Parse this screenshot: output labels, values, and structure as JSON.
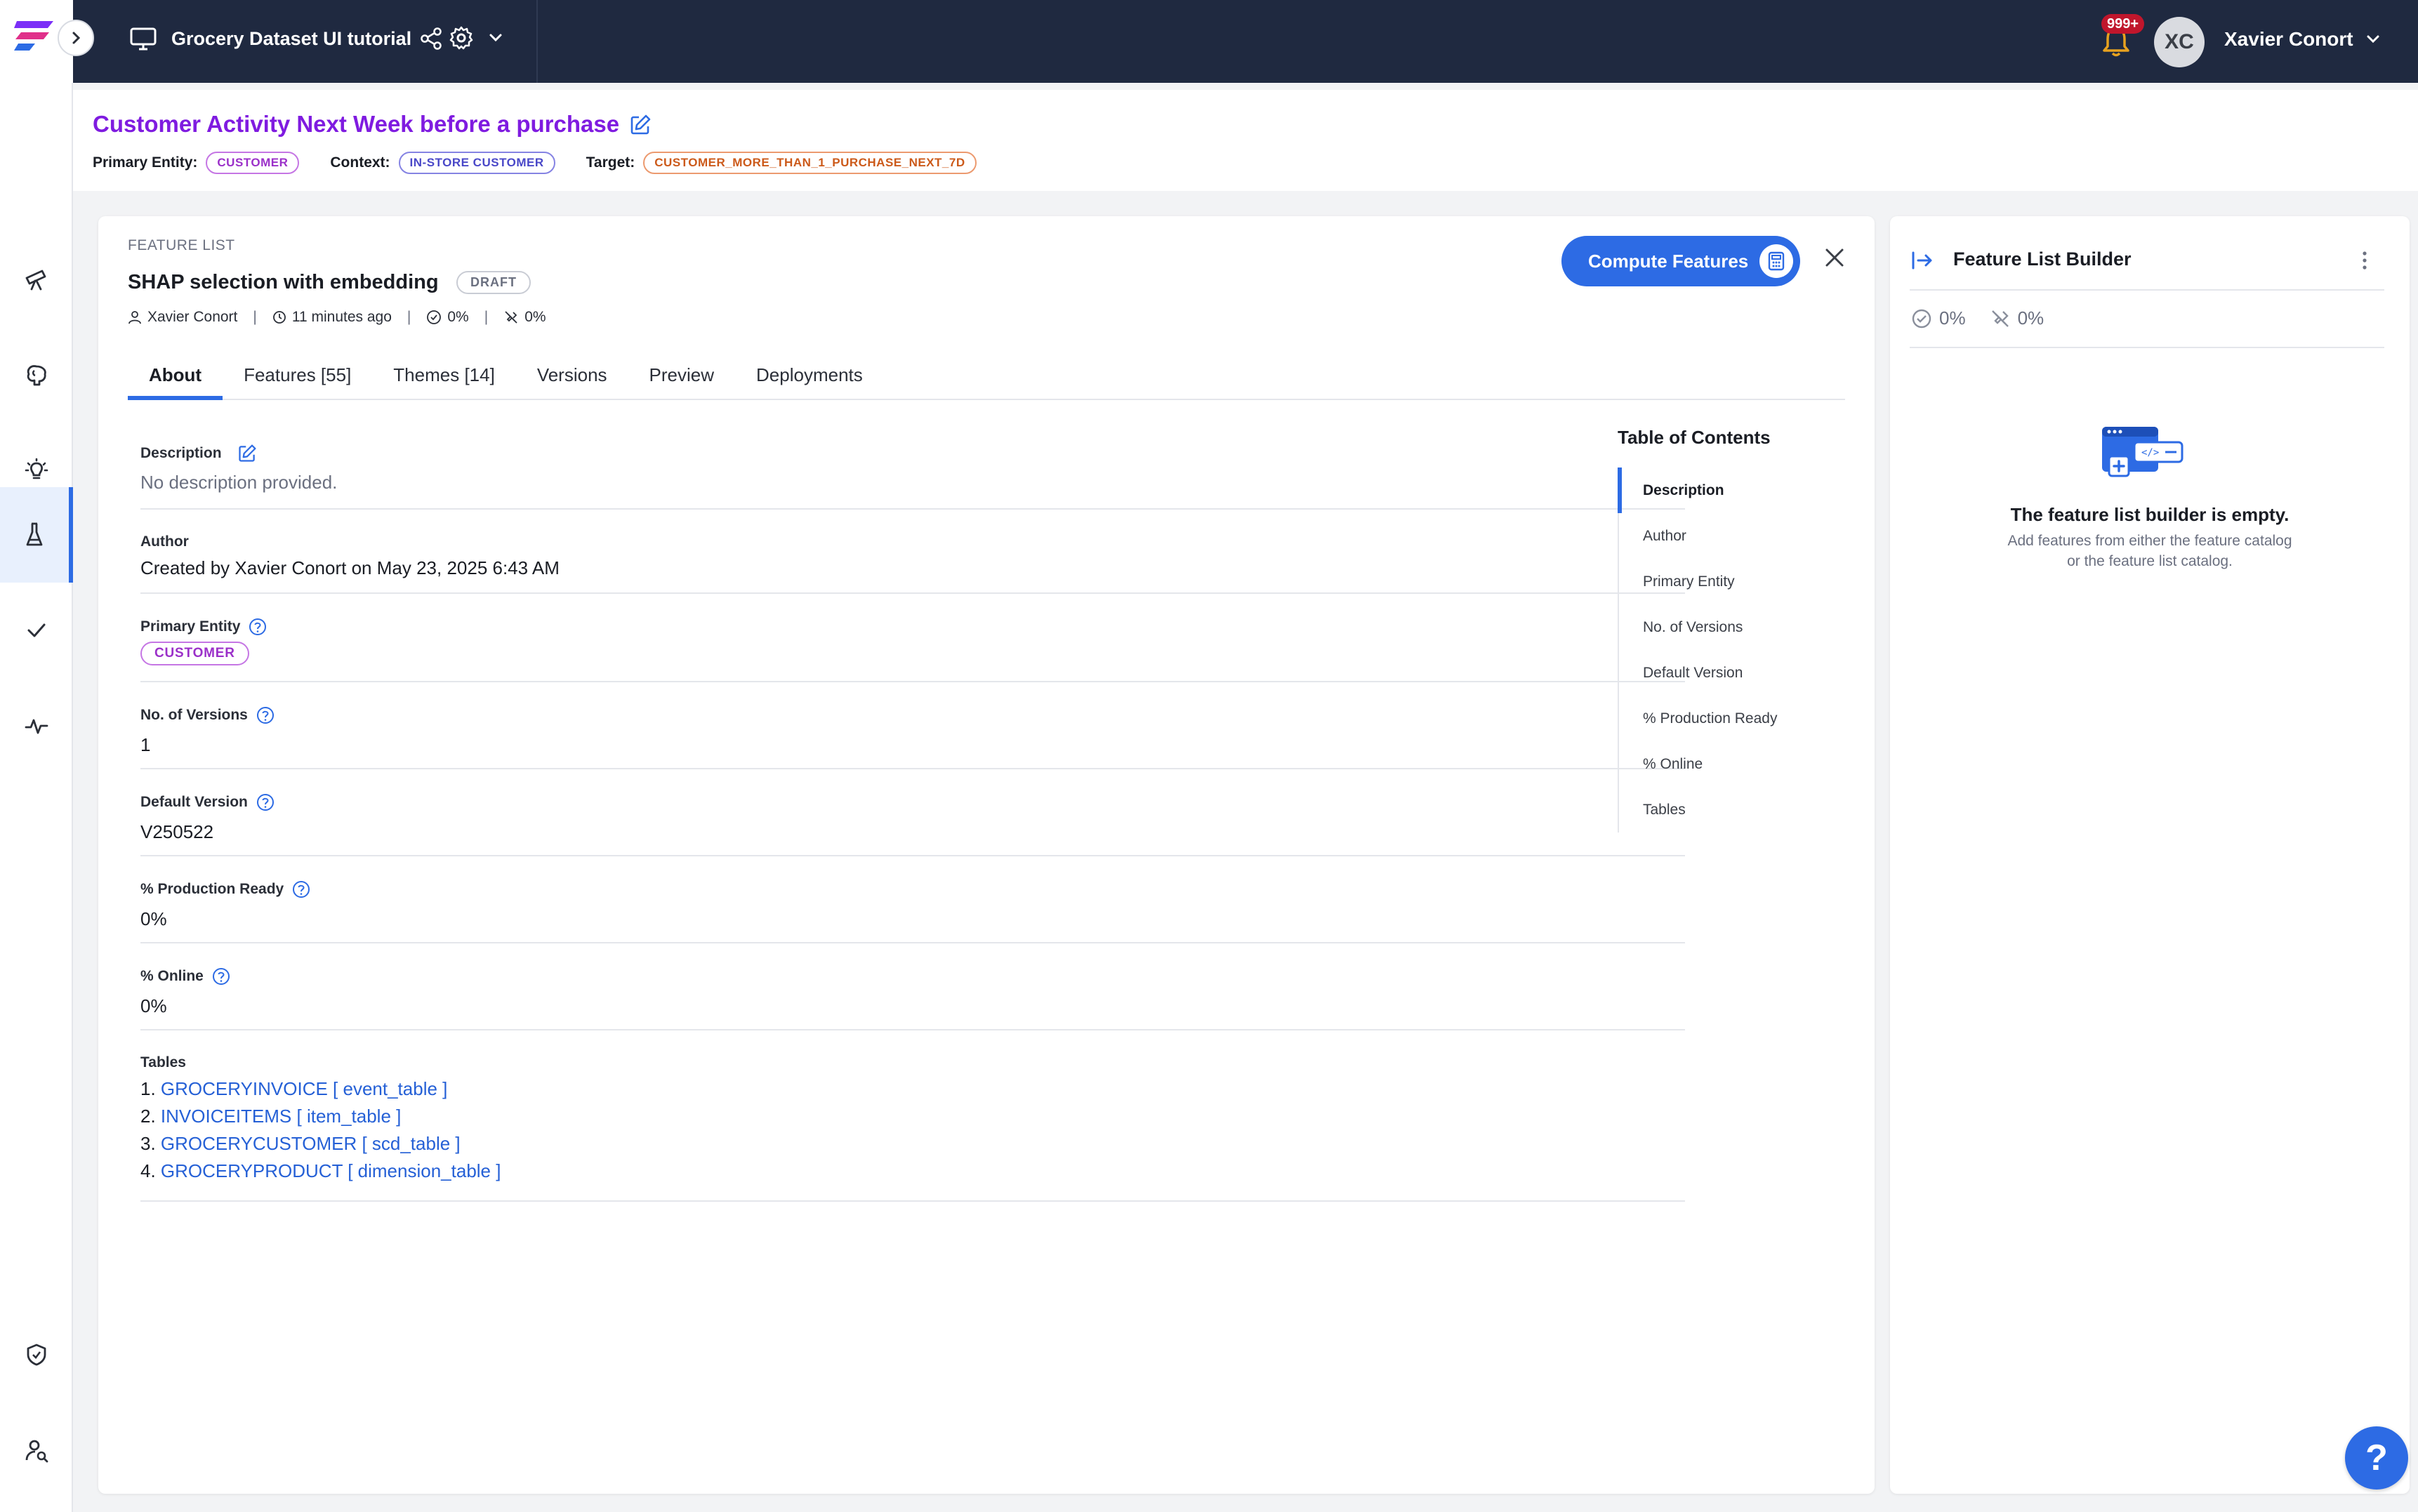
{
  "topbar": {
    "project_title": "Grocery Dataset UI tutorial",
    "notification_count": "999+",
    "user_initials": "XC",
    "user_name": "Xavier Conort"
  },
  "header": {
    "title": "Customer Activity Next Week before a purchase",
    "primary_entity_label": "Primary Entity:",
    "primary_entity": "CUSTOMER",
    "context_label": "Context:",
    "context": "IN-STORE CUSTOMER",
    "target_label": "Target:",
    "target": "CUSTOMER_MORE_THAN_1_PURCHASE_NEXT_7D"
  },
  "feature_list": {
    "eyebrow": "FEATURE LIST",
    "name": "SHAP selection with embedding",
    "status": "DRAFT",
    "owner": "Xavier Conort",
    "updated": "11 minutes ago",
    "production_ready_pct": "0%",
    "online_pct": "0%",
    "compute_label": "Compute Features"
  },
  "tabs": [
    {
      "label": "About"
    },
    {
      "label": "Features [55]"
    },
    {
      "label": "Themes [14]"
    },
    {
      "label": "Versions"
    },
    {
      "label": "Preview"
    },
    {
      "label": "Deployments"
    }
  ],
  "about": {
    "description_label": "Description",
    "description_value": "No description provided.",
    "author_label": "Author",
    "author_value": "Created by Xavier Conort on May 23, 2025 6:43 AM",
    "primary_entity_label": "Primary Entity",
    "primary_entity_value": "CUSTOMER",
    "versions_label": "No. of Versions",
    "versions_value": "1",
    "default_version_label": "Default Version",
    "default_version_value": "V250522",
    "production_ready_label": "% Production Ready",
    "production_ready_value": "0%",
    "online_label": "% Online",
    "online_value": "0%",
    "tables_label": "Tables",
    "tables": [
      {
        "num": "1.",
        "name": "GROCERYINVOICE [ event_table ]"
      },
      {
        "num": "2.",
        "name": "INVOICEITEMS [ item_table ]"
      },
      {
        "num": "3.",
        "name": "GROCERYCUSTOMER [ scd_table ]"
      },
      {
        "num": "4.",
        "name": "GROCERYPRODUCT [ dimension_table ]"
      }
    ]
  },
  "toc": {
    "title": "Table of Contents",
    "items": [
      {
        "label": "Description"
      },
      {
        "label": "Author"
      },
      {
        "label": "Primary Entity"
      },
      {
        "label": "No. of Versions"
      },
      {
        "label": "Default Version"
      },
      {
        "label": "% Production Ready"
      },
      {
        "label": "% Online"
      },
      {
        "label": "Tables"
      }
    ]
  },
  "builder": {
    "title": "Feature List Builder",
    "production_ready_pct": "0%",
    "online_pct": "0%",
    "empty_title": "The feature list builder is empty.",
    "empty_hint_line1": "Add features from either the feature catalog",
    "empty_hint_line2": "or the feature list catalog."
  },
  "help": {
    "label": "?"
  },
  "colors": {
    "topbar": "#1f2940",
    "accent": "#2d6be4",
    "title_purple": "#7f1be0",
    "entity_pill": "#9b30c9",
    "context_pill": "#4a48c8",
    "target_pill": "#cc5a1a",
    "badge_red": "#c0162c"
  }
}
